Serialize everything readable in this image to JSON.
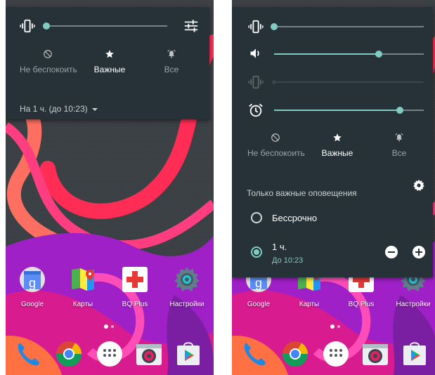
{
  "left_screen": {
    "modes": [
      {
        "label": "Не беспокоить",
        "icon": "do-not-disturb-icon"
      },
      {
        "label": "Важные",
        "icon": "star-icon"
      },
      {
        "label": "Все",
        "icon": "alarm-bell-icon"
      }
    ],
    "active_mode": "Важные",
    "duration_dropdown": "На 1 ч. (до 10:23)",
    "volume_level": 0.0
  },
  "right_screen": {
    "sliders": [
      {
        "icon": "vibrate-icon",
        "level": 0.0
      },
      {
        "icon": "speaker-volume-icon",
        "level": 0.7
      },
      {
        "icon": "vibrate-disabled-icon",
        "level": 0.0,
        "disabled": true
      },
      {
        "icon": "alarm-clock-icon",
        "level": 0.84
      }
    ],
    "modes": [
      {
        "label": "Не беспокоить",
        "icon": "do-not-disturb-icon"
      },
      {
        "label": "Важные",
        "icon": "star-icon"
      },
      {
        "label": "Все",
        "icon": "alarm-bell-icon"
      }
    ],
    "active_mode": "Важные",
    "section_title": "Только важные оповещения",
    "options": [
      {
        "label": "Бессрочно",
        "sublabel": "",
        "selected": false
      },
      {
        "label": "1 ч.",
        "sublabel": "До 10:23",
        "selected": true
      }
    ]
  },
  "home": {
    "apps": [
      {
        "label": "Google",
        "icon": "google-icon"
      },
      {
        "label": "Карты",
        "icon": "maps-icon"
      },
      {
        "label": "BQ Plus",
        "icon": "bq-plus-icon"
      },
      {
        "label": "Настройки",
        "icon": "settings-gear-icon"
      }
    ],
    "dock": [
      "phone-icon",
      "chrome-icon",
      "app-drawer-icon",
      "camera-icon",
      "play-store-icon"
    ]
  },
  "colors": {
    "panel": "#263238",
    "accent": "#80cbc4",
    "wallpaper_dark": "#3a3f44",
    "wallpaper_purple": "#9c27b0",
    "wallpaper_orange": "#ff5722"
  }
}
